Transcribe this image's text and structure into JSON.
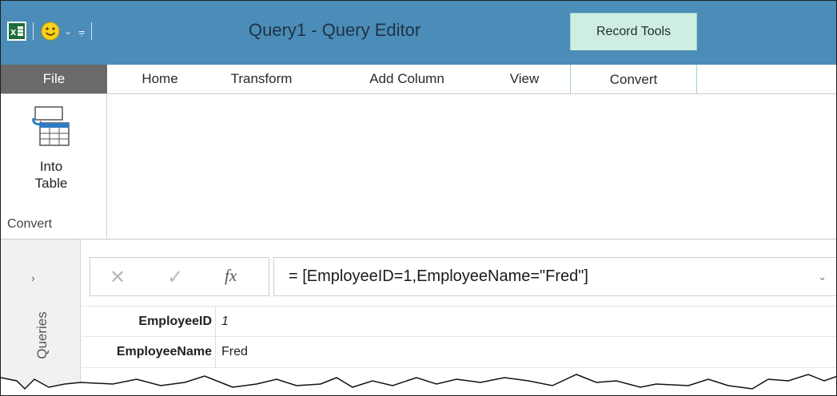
{
  "window": {
    "title": "Query1 - Query Editor",
    "contextual_tab_group": "Record Tools"
  },
  "qat": {
    "app_icon": "excel-icon",
    "feedback_icon": "smiley-icon",
    "customize_icon": "customize-qat-icon"
  },
  "tabs": [
    {
      "label": "File"
    },
    {
      "label": "Home"
    },
    {
      "label": "Transform"
    },
    {
      "label": "Add Column"
    },
    {
      "label": "View"
    },
    {
      "label": "Convert"
    }
  ],
  "ribbon": {
    "into_table": {
      "line1": "Into",
      "line2": "Table",
      "icon": "into-table-icon"
    },
    "group_label": "Convert"
  },
  "queries_pane": {
    "label": "Queries",
    "expand_icon": "chevron-right-icon"
  },
  "formula_bar": {
    "cancel_icon": "close-icon",
    "enter_icon": "check-icon",
    "fx_label": "fx",
    "formula": "= [EmployeeID=1,EmployeeName=\"Fred\"]",
    "expand_icon": "chevron-down-icon"
  },
  "record": {
    "rows": [
      {
        "key": "EmployeeID",
        "value": "1"
      },
      {
        "key": "EmployeeName",
        "value": "Fred"
      }
    ]
  },
  "colors": {
    "titlebar": "#4b8cb8",
    "contextual_tab": "#cdeee0",
    "file_tab": "#6a6a6a"
  }
}
